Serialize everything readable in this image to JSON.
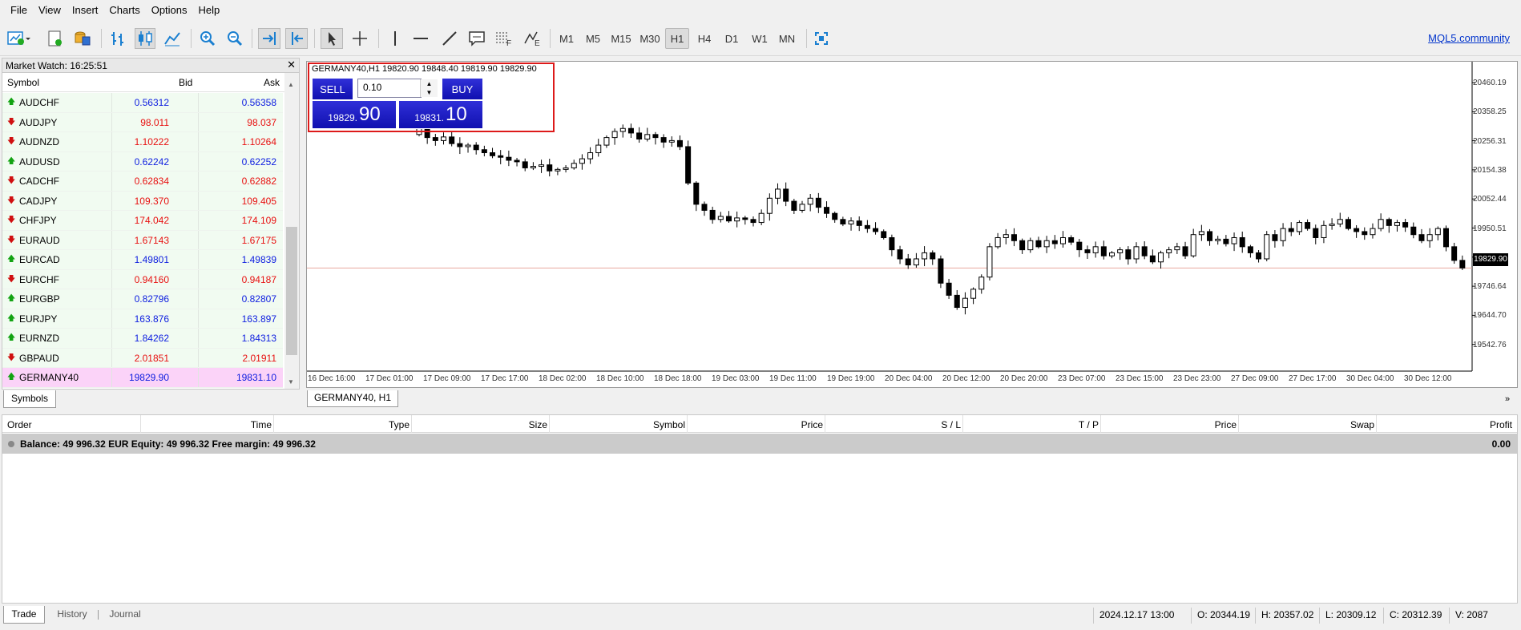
{
  "menu": [
    "File",
    "View",
    "Insert",
    "Charts",
    "Options",
    "Help"
  ],
  "toolbar": {
    "timeframes": [
      "M1",
      "M5",
      "M15",
      "M30",
      "H1",
      "H4",
      "D1",
      "W1",
      "MN"
    ],
    "selected_timeframe": "H1",
    "community_link": "MQL5.community"
  },
  "market_watch": {
    "title": "Market Watch: 16:25:51",
    "headers": {
      "symbol": "Symbol",
      "bid": "Bid",
      "ask": "Ask"
    },
    "rows": [
      {
        "symbol": "AUDCHF",
        "bid": "0.56312",
        "ask": "0.56358",
        "dir": "up"
      },
      {
        "symbol": "AUDJPY",
        "bid": "98.011",
        "ask": "98.037",
        "dir": "down"
      },
      {
        "symbol": "AUDNZD",
        "bid": "1.10222",
        "ask": "1.10264",
        "dir": "down"
      },
      {
        "symbol": "AUDUSD",
        "bid": "0.62242",
        "ask": "0.62252",
        "dir": "up"
      },
      {
        "symbol": "CADCHF",
        "bid": "0.62834",
        "ask": "0.62882",
        "dir": "down"
      },
      {
        "symbol": "CADJPY",
        "bid": "109.370",
        "ask": "109.405",
        "dir": "down"
      },
      {
        "symbol": "CHFJPY",
        "bid": "174.042",
        "ask": "174.109",
        "dir": "down"
      },
      {
        "symbol": "EURAUD",
        "bid": "1.67143",
        "ask": "1.67175",
        "dir": "down"
      },
      {
        "symbol": "EURCAD",
        "bid": "1.49801",
        "ask": "1.49839",
        "dir": "up"
      },
      {
        "symbol": "EURCHF",
        "bid": "0.94160",
        "ask": "0.94187",
        "dir": "down"
      },
      {
        "symbol": "EURGBP",
        "bid": "0.82796",
        "ask": "0.82807",
        "dir": "up"
      },
      {
        "symbol": "EURJPY",
        "bid": "163.876",
        "ask": "163.897",
        "dir": "up"
      },
      {
        "symbol": "EURNZD",
        "bid": "1.84262",
        "ask": "1.84313",
        "dir": "up"
      },
      {
        "symbol": "GBPAUD",
        "bid": "2.01851",
        "ask": "2.01911",
        "dir": "down"
      },
      {
        "symbol": "GERMANY40",
        "bid": "19829.90",
        "ask": "19831.10",
        "dir": "up"
      }
    ],
    "selected_index": 14,
    "tab": "Symbols"
  },
  "chart": {
    "info": "GERMANY40,H1  19820.90 19848.40 19819.90 19829.90",
    "tab": "GERMANY40, H1",
    "trade": {
      "sell_label": "SELL",
      "buy_label": "BUY",
      "lot": "0.10",
      "sell_price_small": "19829.",
      "sell_price_big": "90",
      "buy_price_small": "19831.",
      "buy_price_big": "10"
    },
    "y_ticks": [
      "20460.19",
      "20358.25",
      "20256.31",
      "20154.38",
      "20052.44",
      "19950.51",
      "19848.57",
      "19746.64",
      "19644.70",
      "19542.76"
    ],
    "current_price": "19829.90",
    "x_ticks": [
      "16 Dec 16:00",
      "17 Dec 01:00",
      "17 Dec 09:00",
      "17 Dec 17:00",
      "18 Dec 02:00",
      "18 Dec 10:00",
      "18 Dec 18:00",
      "19 Dec 03:00",
      "19 Dec 11:00",
      "19 Dec 19:00",
      "20 Dec 04:00",
      "20 Dec 12:00",
      "20 Dec 20:00",
      "23 Dec 07:00",
      "23 Dec 15:00",
      "23 Dec 23:00",
      "27 Dec 09:00",
      "27 Dec 17:00",
      "30 Dec 04:00",
      "30 Dec 12:00"
    ]
  },
  "chart_data": {
    "type": "candlestick",
    "symbol": "GERMANY40",
    "timeframe": "H1",
    "ylim": [
      19490,
      20510
    ],
    "closes": [
      20290,
      20260,
      20250,
      20262,
      20240,
      20230,
      20235,
      20220,
      20210,
      20200,
      20195,
      20185,
      20180,
      20160,
      20165,
      20170,
      20150,
      20155,
      20160,
      20175,
      20190,
      20210,
      20235,
      20260,
      20280,
      20290,
      20275,
      20255,
      20270,
      20260,
      20245,
      20250,
      20230,
      20110,
      20040,
      20020,
      19990,
      20000,
      19985,
      19995,
      19990,
      19980,
      20010,
      20060,
      20090,
      20050,
      20020,
      20040,
      20060,
      20030,
      20010,
      19990,
      19975,
      19985,
      19970,
      19960,
      19950,
      19930,
      19890,
      19860,
      19840,
      19860,
      19880,
      19860,
      19780,
      19740,
      19700,
      19730,
      19760,
      19800,
      19900,
      19930,
      19940,
      19920,
      19890,
      19920,
      19900,
      19920,
      19910,
      19930,
      19915,
      19890,
      19880,
      19900,
      19870,
      19880,
      19890,
      19860,
      19900,
      19870,
      19850,
      19880,
      19890,
      19900,
      19870,
      19940,
      19950,
      19920,
      19925,
      19910,
      19930,
      19900,
      19880,
      19860,
      19940,
      19920,
      19960,
      19950,
      19980,
      19960,
      19930,
      19970,
      19975,
      19990,
      19960,
      19950,
      19940,
      19960,
      19990,
      19970,
      19980,
      19965,
      19940,
      19920,
      19940,
      19960,
      19900,
      19855,
      19830
    ]
  },
  "terminal": {
    "headers": [
      "Order",
      "Time",
      "Type",
      "Size",
      "Symbol",
      "Price",
      "S / L",
      "T / P",
      "Price",
      "Swap",
      "Profit"
    ],
    "balance_text": "Balance: 49 996.32 EUR  Equity: 49 996.32  Free margin: 49 996.32",
    "profit": "0.00",
    "tabs": [
      "Trade",
      "History",
      "Journal"
    ],
    "active_tab": "Trade"
  },
  "status": {
    "time": "2024.12.17 13:00",
    "open": "O: 20344.19",
    "high": "H: 20357.02",
    "low": "L: 20309.12",
    "close": "C: 20312.39",
    "volume": "V: 2087"
  },
  "colors": {
    "accent": "#1a1ad0",
    "bid_up": "#1020e0",
    "bid_down": "#e81010",
    "row_bg": "#f1fbf1",
    "row_selected": "#fbd3f8"
  }
}
